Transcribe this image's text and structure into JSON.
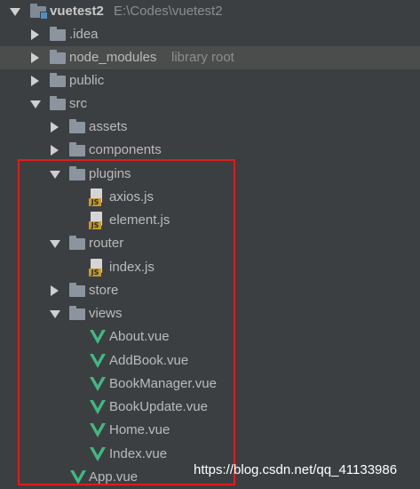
{
  "project": {
    "name": "vuetest2",
    "path": "E:\\Codes\\vuetest2"
  },
  "tree": {
    "idea": ".idea",
    "node_modules": "node_modules",
    "node_modules_hint": "library root",
    "public": "public",
    "src": "src",
    "assets": "assets",
    "components": "components",
    "plugins": "plugins",
    "axios": "axios.js",
    "element": "element.js",
    "router": "router",
    "index_js": "index.js",
    "store": "store",
    "views": "views",
    "about": "About.vue",
    "addbook": "AddBook.vue",
    "bookmanager": "BookManager.vue",
    "bookupdate": "BookUpdate.vue",
    "home": "Home.vue",
    "index_vue": "Index.vue",
    "app": "App.vue"
  },
  "file_badge": "JS",
  "colors": {
    "highlight": "#e21b1b",
    "vue_green": "#41b883",
    "js_tag": "#c89a2a"
  },
  "watermark": "https://blog.csdn.net/qq_41133986"
}
